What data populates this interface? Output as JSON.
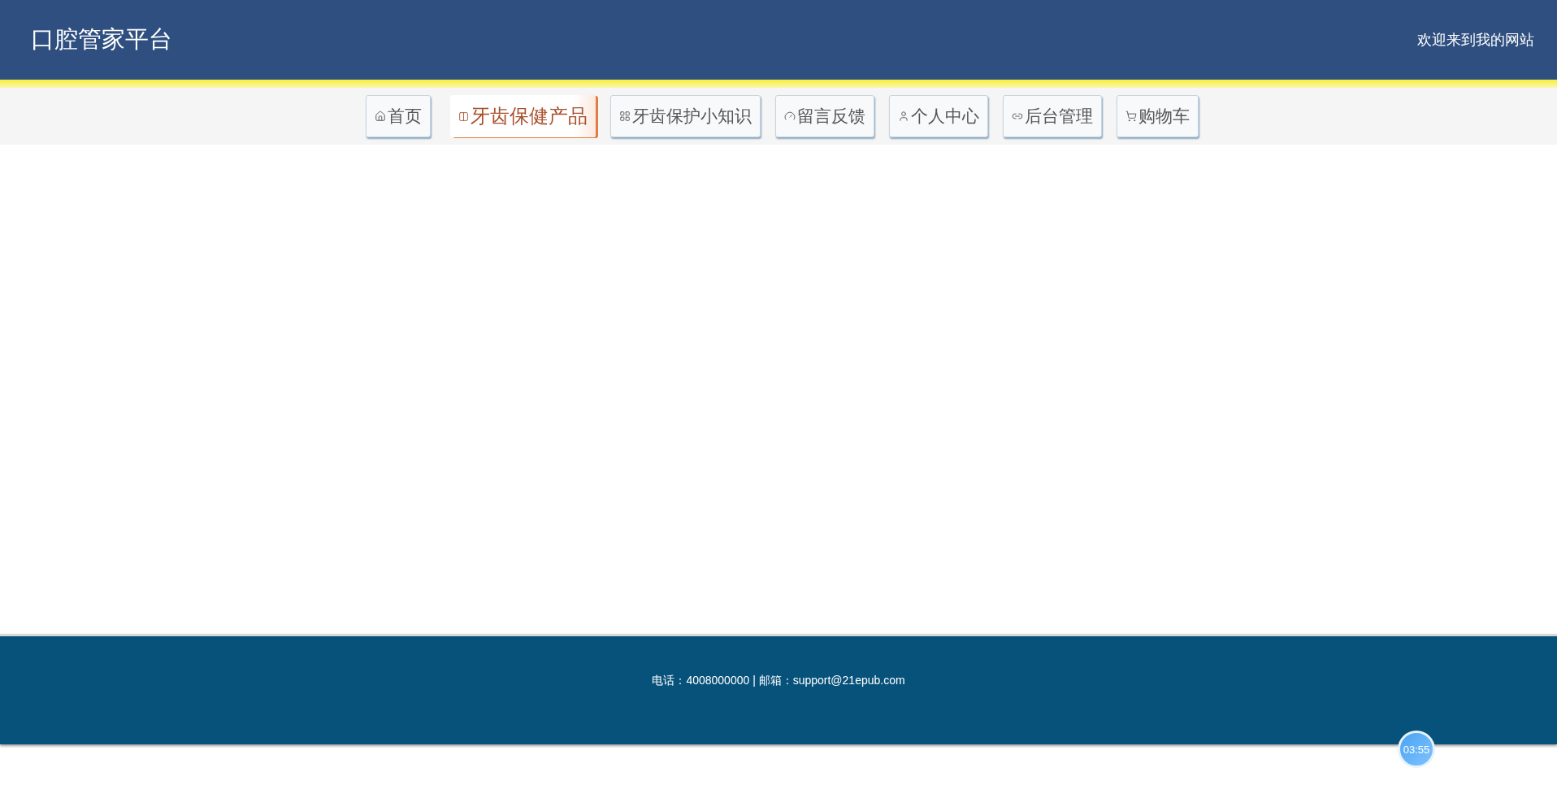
{
  "header": {
    "title": "口腔管家平台",
    "welcome": "欢迎来到我的网站"
  },
  "nav": [
    {
      "label": "首页",
      "selected": false
    },
    {
      "label": "牙齿保健产品",
      "selected": true
    },
    {
      "label": "牙齿保护小知识",
      "selected": false
    },
    {
      "label": "留言反馈",
      "selected": false
    },
    {
      "label": "个人中心",
      "selected": false
    },
    {
      "label": "后台管理",
      "selected": false
    },
    {
      "label": "购物车",
      "selected": false
    }
  ],
  "footer": {
    "contact": "电话：4008000000 | 邮箱：support@21epub.com"
  },
  "timer": "03:55"
}
